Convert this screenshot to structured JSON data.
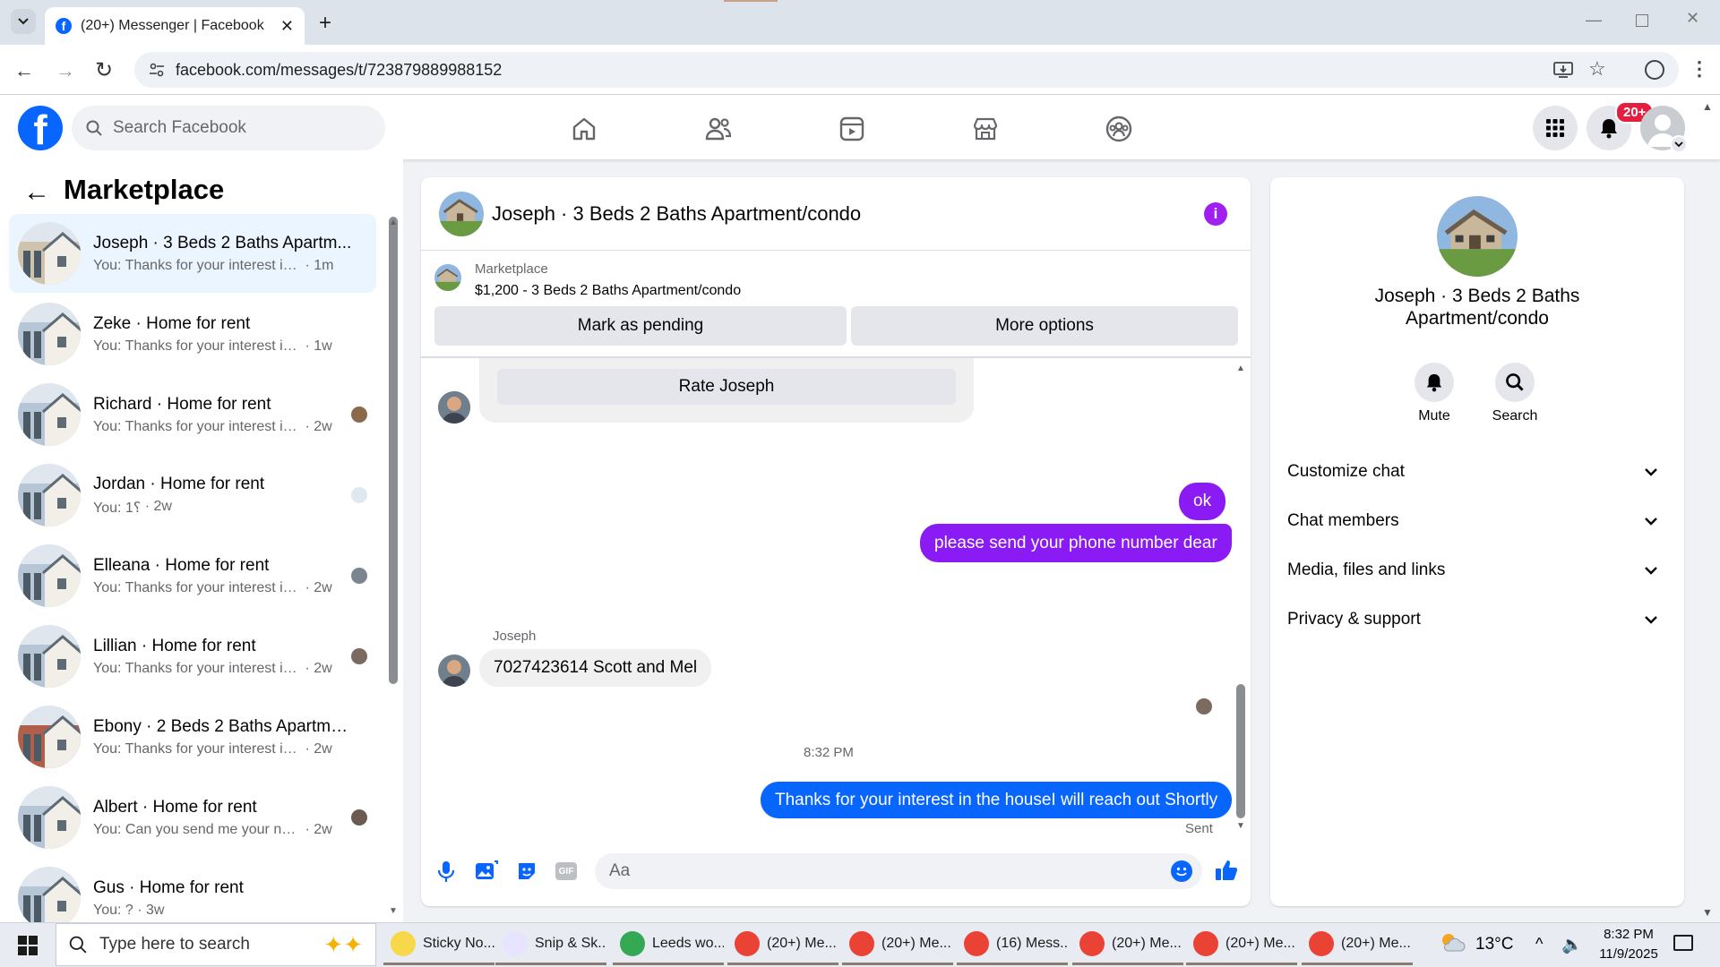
{
  "browser": {
    "tab_title": "(20+) Messenger | Facebook",
    "url": "facebook.com/messages/t/723879889988152"
  },
  "fb": {
    "search_placeholder": "Search Facebook",
    "notification_badge": "20+"
  },
  "left": {
    "title": "Marketplace",
    "conversations": [
      {
        "name": "Joseph · 3 Beds 2 Baths Apartm...",
        "preview": "You: Thanks for your interest in the...",
        "time": "1m",
        "active": true
      },
      {
        "name": "Zeke · Home for rent",
        "preview": "You: Thanks for your interest in the...",
        "time": "1w"
      },
      {
        "name": "Richard · Home for rent",
        "preview": "You: Thanks for your interest in t...",
        "time": "2w"
      },
      {
        "name": "Jordan · Home for rent",
        "preview": "You: 1؟",
        "time": "2w"
      },
      {
        "name": "Elleana · Home for rent",
        "preview": "You: Thanks for your interest in t...",
        "time": "2w"
      },
      {
        "name": "Lillian · Home for rent",
        "preview": "You: Thanks for your interest in t...",
        "time": "2w"
      },
      {
        "name": "Ebony · 2 Beds 2 Baths Apartme...",
        "preview": "You: Thanks for your interest in the...",
        "time": "2w"
      },
      {
        "name": "Albert · Home for rent",
        "preview": "You: Can you send me your nu...",
        "time": "2w"
      },
      {
        "name": "Gus · Home for rent",
        "preview": "You: ?",
        "time": "3w"
      }
    ]
  },
  "chat": {
    "title": "Joseph · 3 Beds 2 Baths Apartment/condo",
    "listing_source": "Marketplace",
    "listing_title": "$1,200 - 3 Beds 2 Baths Apartment/condo",
    "mark_pending": "Mark as pending",
    "more_options": "More options",
    "rate_button": "Rate Joseph",
    "msg_ok": "ok",
    "msg_phone_request": "please send your phone number dear",
    "sender_name": "Joseph",
    "msg_reply": "7027423614 Scott and Mel",
    "timestamp": "8:32 PM",
    "msg_last": "Thanks for your interest in the houseI will reach out Shortly",
    "status": "Sent",
    "composer_placeholder": "Aa"
  },
  "info": {
    "name": "Joseph · 3 Beds 2 Baths Apartment/condo",
    "mute": "Mute",
    "search": "Search",
    "sections": [
      "Customize chat",
      "Chat members",
      "Media, files and links",
      "Privacy & support"
    ]
  },
  "taskbar": {
    "search_placeholder": "Type here to search",
    "items": [
      "Sticky No...",
      "Snip & Sk...",
      "Leeds wo...",
      "(20+) Me...",
      "(20+) Me...",
      "(16) Mess...",
      "(20+) Me...",
      "(20+) Me...",
      "(20+) Me..."
    ],
    "weather": "13°C",
    "time": "8:32 PM",
    "date": "11/9/2025"
  },
  "colors": {
    "brand": "#0866ff",
    "outgoing": "#8a1bf5",
    "accent_purple": "#a020f0"
  }
}
